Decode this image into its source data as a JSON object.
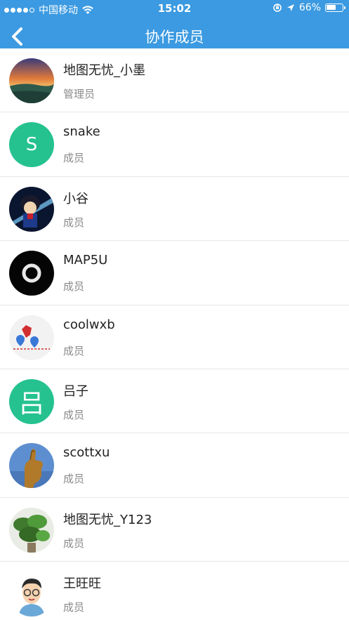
{
  "status_bar": {
    "carrier": "中国移动",
    "time": "15:02",
    "battery_percent": "66%",
    "battery_level": 0.66
  },
  "nav": {
    "title": "协作成员",
    "back_icon": "chevron-left-icon"
  },
  "members": [
    {
      "name": "地图无忧_小墨",
      "role": "管理员",
      "avatar": "photo-sunset-landscape"
    },
    {
      "name": "snake",
      "role": "成员",
      "avatar_letter": "S"
    },
    {
      "name": "小谷",
      "role": "成员",
      "avatar": "photo-anime-character"
    },
    {
      "name": "MAP5U",
      "role": "成员",
      "avatar": "photo-black-ring"
    },
    {
      "name": "coolwxb",
      "role": "成员",
      "avatar": "photo-map-pins"
    },
    {
      "name": "吕子",
      "role": "成员",
      "avatar_letter": "吕"
    },
    {
      "name": "scottxu",
      "role": "成员",
      "avatar": "photo-thumbs-up-statue"
    },
    {
      "name": "地图无忧_Y123",
      "role": "成员",
      "avatar": "photo-green-plant"
    },
    {
      "name": "王旺旺",
      "role": "成员",
      "avatar": "photo-cartoon-man"
    }
  ],
  "colors": {
    "header_blue": "#3b9ae1",
    "letter_avatar_green": "#25c290",
    "role_gray": "#8a8a8a"
  }
}
